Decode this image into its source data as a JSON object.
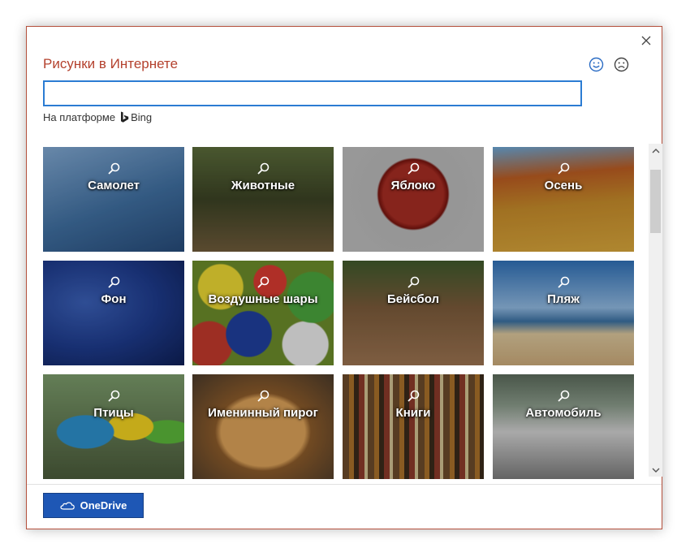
{
  "dialog": {
    "title": "Рисунки в Интернете",
    "search": {
      "value": "",
      "placeholder": ""
    },
    "powered_by": {
      "prefix": "На платформе",
      "provider": "Bing"
    },
    "accent_color": "#b4412d",
    "focus_color": "#2b7cd3"
  },
  "tiles": [
    {
      "label": "Самолет"
    },
    {
      "label": "Животные"
    },
    {
      "label": "Яблоко"
    },
    {
      "label": "Осень"
    },
    {
      "label": "Фон"
    },
    {
      "label": "Воздушные шары"
    },
    {
      "label": "Бейсбол"
    },
    {
      "label": "Пляж"
    },
    {
      "label": "Птицы"
    },
    {
      "label": "Именинный пирог"
    },
    {
      "label": "Книги"
    },
    {
      "label": "Автомобиль"
    }
  ],
  "footer": {
    "onedrive_label": "OneDrive",
    "button_color": "#1e57b5"
  },
  "icons": {
    "close": "close-icon",
    "smile": "smile-icon",
    "frown": "frown-icon",
    "bing": "bing-logo-icon",
    "tile_search": "magnifier-icon",
    "cloud": "cloud-icon"
  }
}
